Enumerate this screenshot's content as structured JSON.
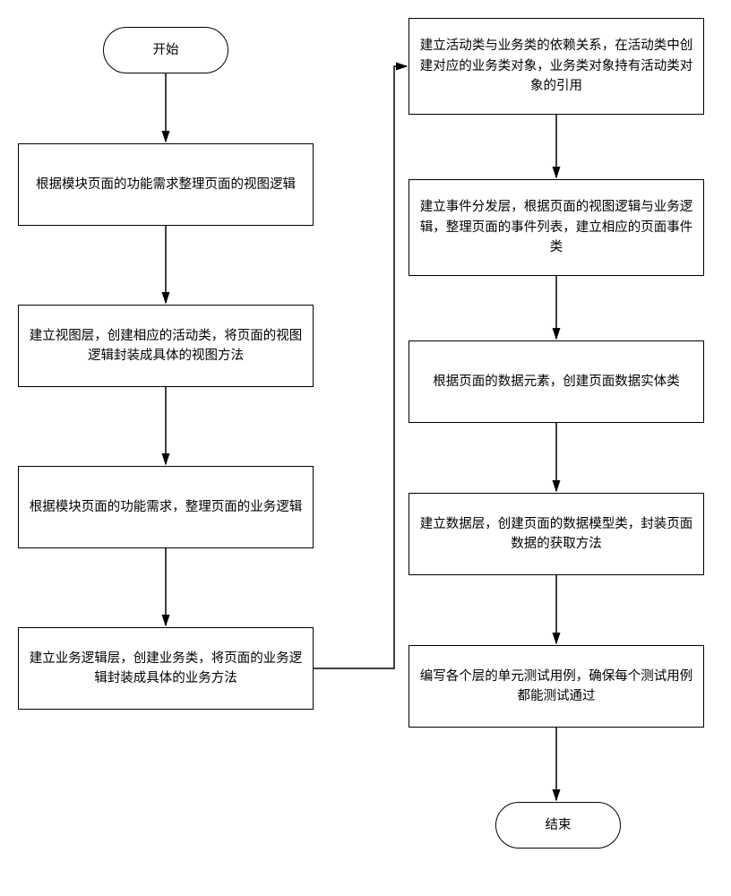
{
  "start": "开始",
  "end": "结束",
  "steps": {
    "s1": "根据模块页面的功能需求整理页面的视图逻辑",
    "s2": "建立视图层，创建相应的活动类，将页面的视图逻辑封装成具体的视图方法",
    "s3": "根据模块页面的功能需求，整理页面的业务逻辑",
    "s4": "建立业务逻辑层，创建业务类，将页面的业务逻辑封装成具体的业务方法",
    "s5": "建立活动类与业务类的依赖关系，在活动类中创建对应的业务类对象，业务类对象持有活动类对象的引用",
    "s6": "建立事件分发层，根据页面的视图逻辑与业务逻辑，整理页面的事件列表，建立相应的页面事件类",
    "s7": "根据页面的数据元素，创建页面数据实体类",
    "s8": "建立数据层，创建页面的数据模型类，封装页面数据的获取方法",
    "s9": "编写各个层的单元测试用例，确保每个测试用例都能测试通过"
  }
}
